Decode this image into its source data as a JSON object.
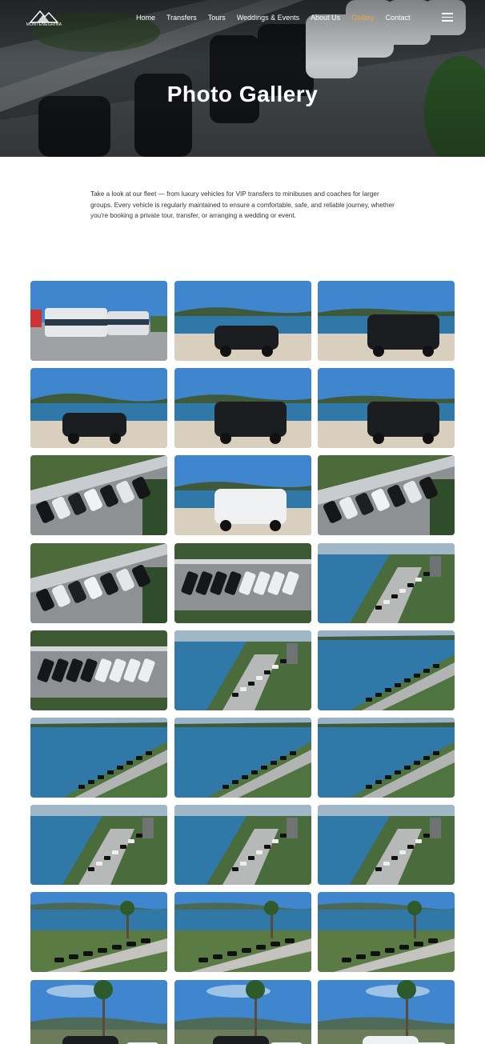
{
  "brand": {
    "logo_text": "MONTENEGRINA"
  },
  "nav": {
    "items": [
      {
        "label": "Home",
        "active": false
      },
      {
        "label": "Transfers",
        "active": false
      },
      {
        "label": "Tours",
        "active": false
      },
      {
        "label": "Weddings & Events",
        "active": false
      },
      {
        "label": "About Us",
        "active": false
      },
      {
        "label": "Gallery",
        "active": true
      },
      {
        "label": "Contact",
        "active": false
      }
    ],
    "accent_color": "#e3a94e"
  },
  "hero": {
    "title": "Photo Gallery"
  },
  "intro": {
    "text": "Take a look at our fleet — from luxury vehicles for VIP transfers to minibuses and coaches for larger groups. Every vehicle is regularly maintained to ensure a comfortable, safe, and reliable journey, whether you're booking a private tour, transfer, or arranging a wedding or event."
  },
  "gallery": {
    "photos": [
      {
        "scene": "coaches"
      },
      {
        "scene": "sedan-beach"
      },
      {
        "scene": "van-beach"
      },
      {
        "scene": "sedan-beach"
      },
      {
        "scene": "van-beach"
      },
      {
        "scene": "van-beach"
      },
      {
        "scene": "parking-aerial"
      },
      {
        "scene": "white-van-beach"
      },
      {
        "scene": "parking-aerial"
      },
      {
        "scene": "parking-aerial"
      },
      {
        "scene": "parking-top"
      },
      {
        "scene": "coast-road"
      },
      {
        "scene": "parking-top"
      },
      {
        "scene": "coast-road"
      },
      {
        "scene": "coast-sea"
      },
      {
        "scene": "coast-sea"
      },
      {
        "scene": "coast-sea"
      },
      {
        "scene": "coast-sea"
      },
      {
        "scene": "coast-road"
      },
      {
        "scene": "coast-road"
      },
      {
        "scene": "coast-road"
      },
      {
        "scene": "coast-palms"
      },
      {
        "scene": "coast-palms"
      },
      {
        "scene": "coast-palms"
      },
      {
        "scene": "palms-vans"
      },
      {
        "scene": "palms-vans"
      },
      {
        "scene": "palms-vans"
      }
    ]
  }
}
